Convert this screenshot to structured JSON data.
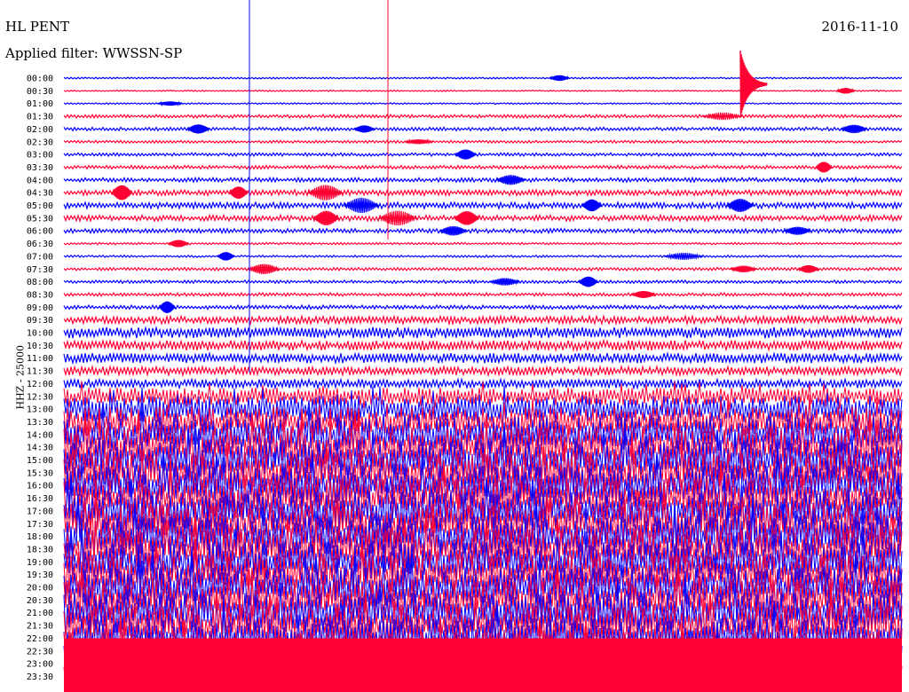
{
  "header": {
    "station": "HL PENT",
    "date": "2016-11-10",
    "filter": "Applied filter: WWSSN-SP"
  },
  "chart_data": {
    "type": "line",
    "title": "HL PENT",
    "subtitle": "Applied filter: WWSSN-SP",
    "ylabel": "HHZ - 25000",
    "xlabel": "",
    "grid": false,
    "legend": "none",
    "colors": {
      "odd_trace": "#0000ff",
      "even_trace": "#ff0033"
    },
    "rows": [
      {
        "time": "00:00",
        "amp": 0.8
      },
      {
        "time": "00:30",
        "amp": 0.6
      },
      {
        "time": "01:00",
        "amp": 0.7
      },
      {
        "time": "01:30",
        "amp": 1.5
      },
      {
        "time": "02:00",
        "amp": 1.6
      },
      {
        "time": "02:30",
        "amp": 1.2
      },
      {
        "time": "03:00",
        "amp": 1.5
      },
      {
        "time": "03:30",
        "amp": 1.6
      },
      {
        "time": "04:00",
        "amp": 2.0
      },
      {
        "time": "04:30",
        "amp": 2.6
      },
      {
        "time": "05:00",
        "amp": 2.8
      },
      {
        "time": "05:30",
        "amp": 2.6
      },
      {
        "time": "06:00",
        "amp": 2.0
      },
      {
        "time": "06:30",
        "amp": 1.0
      },
      {
        "time": "07:00",
        "amp": 1.0
      },
      {
        "time": "07:30",
        "amp": 1.4
      },
      {
        "time": "08:00",
        "amp": 1.4
      },
      {
        "time": "08:30",
        "amp": 1.5
      },
      {
        "time": "09:00",
        "amp": 1.8
      },
      {
        "time": "09:30",
        "amp": 3.5
      },
      {
        "time": "10:00",
        "amp": 5.0
      },
      {
        "time": "10:30",
        "amp": 4.5
      },
      {
        "time": "11:00",
        "amp": 4.5
      },
      {
        "time": "11:30",
        "amp": 4.0
      },
      {
        "time": "12:00",
        "amp": 4.0
      },
      {
        "time": "12:30",
        "amp": 8.0
      },
      {
        "time": "13:00",
        "amp": 12.0
      },
      {
        "time": "13:30",
        "amp": 14.0
      },
      {
        "time": "14:00",
        "amp": 16.0
      },
      {
        "time": "14:30",
        "amp": 18.0
      },
      {
        "time": "15:00",
        "amp": 18.0
      },
      {
        "time": "15:30",
        "amp": 18.0
      },
      {
        "time": "16:00",
        "amp": 18.0
      },
      {
        "time": "16:30",
        "amp": 18.0
      },
      {
        "time": "17:00",
        "amp": 18.0
      },
      {
        "time": "17:30",
        "amp": 18.0
      },
      {
        "time": "18:00",
        "amp": 18.0
      },
      {
        "time": "18:30",
        "amp": 18.0
      },
      {
        "time": "19:00",
        "amp": 18.0
      },
      {
        "time": "19:30",
        "amp": 18.0
      },
      {
        "time": "20:00",
        "amp": 18.0
      },
      {
        "time": "20:30",
        "amp": 18.0
      },
      {
        "time": "21:00",
        "amp": 18.0
      },
      {
        "time": "21:30",
        "amp": 18.0
      },
      {
        "time": "22:00",
        "amp": 18.0
      },
      {
        "time": "22:30",
        "amp": 18.0
      },
      {
        "time": "23:00",
        "amp": 18.0
      },
      {
        "time": "23:30",
        "amp": 18.0
      }
    ]
  }
}
